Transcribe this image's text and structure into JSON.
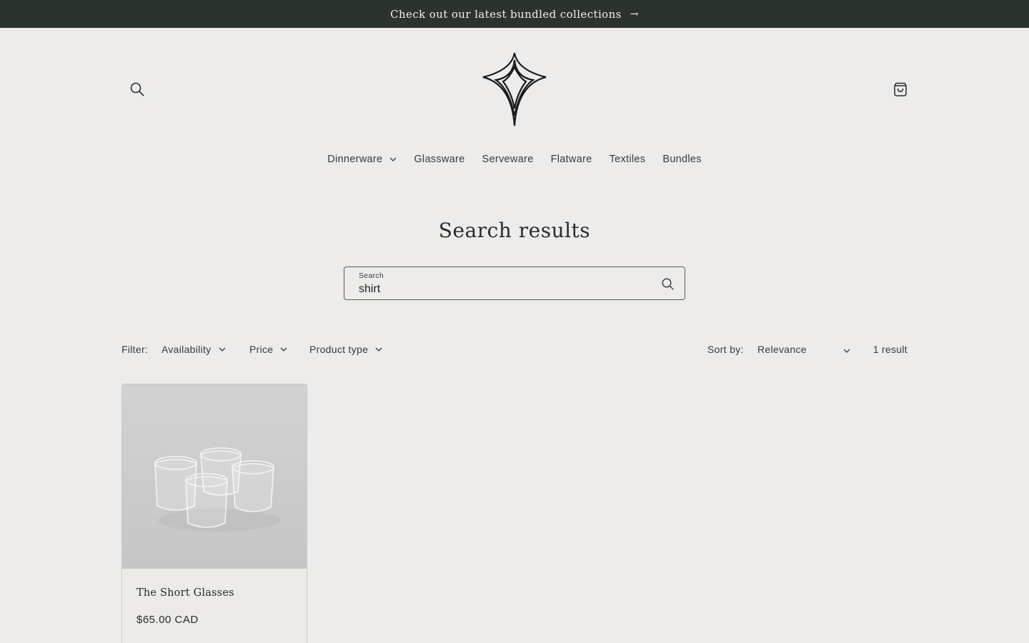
{
  "announcement": {
    "text": "Check out our latest bundled collections",
    "arrow": "→"
  },
  "header": {
    "search_icon": "search-icon",
    "logo": "star-diamond-logo",
    "cart_icon": "cart-icon"
  },
  "nav": {
    "items": [
      {
        "label": "Dinnerware",
        "has_dropdown": true
      },
      {
        "label": "Glassware",
        "has_dropdown": false
      },
      {
        "label": "Serveware",
        "has_dropdown": false
      },
      {
        "label": "Flatware",
        "has_dropdown": false
      },
      {
        "label": "Textiles",
        "has_dropdown": false
      },
      {
        "label": "Bundles",
        "has_dropdown": false
      }
    ]
  },
  "main": {
    "title": "Search results",
    "search": {
      "label": "Search",
      "value": "shirt"
    }
  },
  "facets": {
    "filter_label": "Filter:",
    "filters": [
      "Availability",
      "Price",
      "Product type"
    ],
    "sort_label": "Sort by:",
    "sort_value": "Relevance",
    "result_count": "1 result"
  },
  "products": [
    {
      "title": "The Short Glasses",
      "price": "$65.00 CAD"
    }
  ],
  "colors": {
    "background": "#edecea",
    "announcement_bg": "#2c332f",
    "text": "#2b2b2b"
  }
}
